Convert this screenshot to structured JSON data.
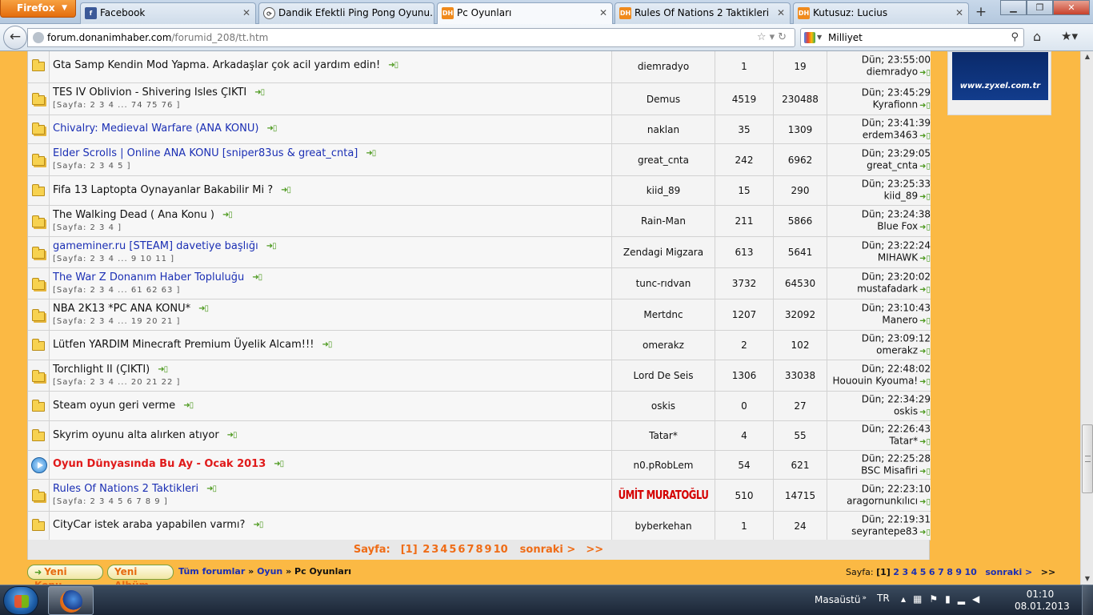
{
  "browser": {
    "app_button": "Firefox",
    "tabs": [
      {
        "label": "Facebook",
        "icon": "facebook-icon",
        "color": "#3b5998",
        "glyph": "f"
      },
      {
        "label": "Dandik Efektli Ping Pong Oyunu...",
        "icon": "reload-icon",
        "color": "#444444",
        "glyph": "⟳"
      },
      {
        "label": "Pc Oyunları",
        "icon": "donanimhaber-icon",
        "color": "#f08a1c",
        "glyph": "DH"
      },
      {
        "label": "Rules Of Nations 2 Taktikleri",
        "icon": "donanimhaber-icon",
        "color": "#f08a1c",
        "glyph": "DH"
      },
      {
        "label": "Kutusuz: Lucius",
        "icon": "donanimhaber-icon",
        "color": "#f08a1c",
        "glyph": "DH"
      }
    ],
    "url_domain": "forum.donanimhaber.com",
    "url_path": "/forumid_208/tt.htm",
    "search_value": "Milliyet"
  },
  "topics": [
    {
      "title": "Gta Samp Kendin Mod Yapma. Arkadaşlar çok acil yardım edin!",
      "style": "normal",
      "pages": "",
      "author": "diemradyo",
      "replies": "1",
      "views": "19",
      "last_time": "Dün; 23:55:00",
      "last_user": "diemradyo",
      "icon": "folder"
    },
    {
      "title": "TES IV Oblivion - Shivering Isles ÇIKTI",
      "style": "normal",
      "pages": "[Sayfa: 2 3 4 ... 74 75 76 ]",
      "author": "Demus",
      "replies": "4519",
      "views": "230488",
      "last_time": "Dün; 23:45:29",
      "last_user": "Kyrafionn",
      "icon": "folder-multi"
    },
    {
      "title": "Chivalry: Medieval Warfare (ANA KONU)",
      "style": "link",
      "pages": "",
      "author": "naklan",
      "replies": "35",
      "views": "1309",
      "last_time": "Dün; 23:41:39",
      "last_user": "erdem3463",
      "icon": "folder-multi"
    },
    {
      "title": "Elder Scrolls | Online ANA KONU [sniper83us & great_cnta]",
      "style": "link",
      "pages": "[Sayfa: 2 3 4 5 ]",
      "author": "great_cnta",
      "replies": "242",
      "views": "6962",
      "last_time": "Dün; 23:29:05",
      "last_user": "great_cnta",
      "icon": "folder-multi"
    },
    {
      "title": "Fifa 13 Laptopta Oynayanlar Bakabilir Mi ?",
      "style": "normal",
      "pages": "",
      "author": "kiid_89",
      "replies": "15",
      "views": "290",
      "last_time": "Dün; 23:25:33",
      "last_user": "kiid_89",
      "icon": "folder"
    },
    {
      "title": "The Walking Dead ( Ana Konu )",
      "style": "normal",
      "pages": "[Sayfa: 2 3 4 ]",
      "author": "Rain-Man",
      "replies": "211",
      "views": "5866",
      "last_time": "Dün; 23:24:38",
      "last_user": "Blue Fox",
      "icon": "folder-multi"
    },
    {
      "title": "gameminer.ru [STEAM] davetiye başlığı",
      "style": "link",
      "pages": "[Sayfa: 2 3 4 ... 9 10 11 ]",
      "author": "Zendagi Migzara",
      "replies": "613",
      "views": "5641",
      "last_time": "Dün; 23:22:24",
      "last_user": "MIHAWK",
      "icon": "folder-multi"
    },
    {
      "title": "The War Z Donanım Haber Topluluğu",
      "style": "link",
      "pages": "[Sayfa: 2 3 4 ... 61 62 63 ]",
      "author": "tunc-rıdvan",
      "replies": "3732",
      "views": "64530",
      "last_time": "Dün; 23:20:02",
      "last_user": "mustafadark",
      "icon": "folder-multi"
    },
    {
      "title": "NBA 2K13 *PC ANA KONU*",
      "style": "normal",
      "pages": "[Sayfa: 2 3 4 ... 19 20 21 ]",
      "author": "Mertdnc",
      "replies": "1207",
      "views": "32092",
      "last_time": "Dün; 23:10:43",
      "last_user": "Manero",
      "icon": "folder-multi"
    },
    {
      "title": "Lütfen YARDIM Minecraft Premium Üyelik Alcam!!!",
      "style": "normal",
      "pages": "",
      "author": "omerakz",
      "replies": "2",
      "views": "102",
      "last_time": "Dün; 23:09:12",
      "last_user": "omerakz",
      "icon": "folder"
    },
    {
      "title": "Torchlight II (ÇIKTI)",
      "style": "normal",
      "pages": "[Sayfa: 2 3 4 ... 20 21 22 ]",
      "author": "Lord De Seis",
      "replies": "1306",
      "views": "33038",
      "last_time": "Dün; 22:48:02",
      "last_user": "Hououin Kyouma!",
      "icon": "folder-multi"
    },
    {
      "title": "Steam oyun geri verme",
      "style": "normal",
      "pages": "",
      "author": "oskis",
      "replies": "0",
      "views": "27",
      "last_time": "Dün; 22:34:29",
      "last_user": "oskis",
      "icon": "folder"
    },
    {
      "title": "Skyrim oyunu alta alırken atıyor",
      "style": "normal",
      "pages": "",
      "author": "Tatar*",
      "replies": "4",
      "views": "55",
      "last_time": "Dün; 22:26:43",
      "last_user": "Tatar*",
      "icon": "folder"
    },
    {
      "title": "Oyun Dünyasında Bu Ay - Ocak 2013",
      "style": "hot",
      "pages": "",
      "author": "n0.pRobLem",
      "replies": "54",
      "views": "621",
      "last_time": "Dün; 22:25:28",
      "last_user": "BSC Misafiri",
      "icon": "announcement"
    },
    {
      "title": "Rules Of Nations 2 Taktikleri",
      "style": "link",
      "pages": "[Sayfa: 2 3 4 5 6 7 8 9 ]",
      "author": "ÜMİT MURATOĞLU",
      "author_style": "red",
      "replies": "510",
      "views": "14715",
      "last_time": "Dün; 22:23:10",
      "last_user": "aragornunkılıcı",
      "icon": "folder-multi"
    },
    {
      "title": "CityCar istek araba yapabilen varmı?",
      "style": "normal",
      "pages": "",
      "author": "byberkehan",
      "replies": "1",
      "views": "24",
      "last_time": "Dün; 22:19:31",
      "last_user": "seyrantepe83",
      "icon": "folder"
    }
  ],
  "pager": {
    "label": "Sayfa:",
    "current": "[1]",
    "pages": [
      "2",
      "3",
      "4",
      "5",
      "6",
      "7",
      "8",
      "9",
      "10"
    ],
    "next": "sonraki >",
    "last": ">>"
  },
  "actions": {
    "new_topic": "Yeni Konu",
    "new_album": "Yeni Albüm"
  },
  "breadcrumb": {
    "items": [
      "Tüm forumlar",
      "Oyun"
    ],
    "current": "Pc Oyunları",
    "separator": "»"
  },
  "ad": {
    "text": "www.zyxel.com.tr"
  },
  "taskbar": {
    "desktop_label": "Masaüstü",
    "language": "TR",
    "time": "01:10",
    "date": "08.01.2013"
  },
  "colors": {
    "page_bg": "#fbb944",
    "link": "#1b2fb4",
    "hot": "#e01a1a",
    "pager": "#ef6c16"
  }
}
